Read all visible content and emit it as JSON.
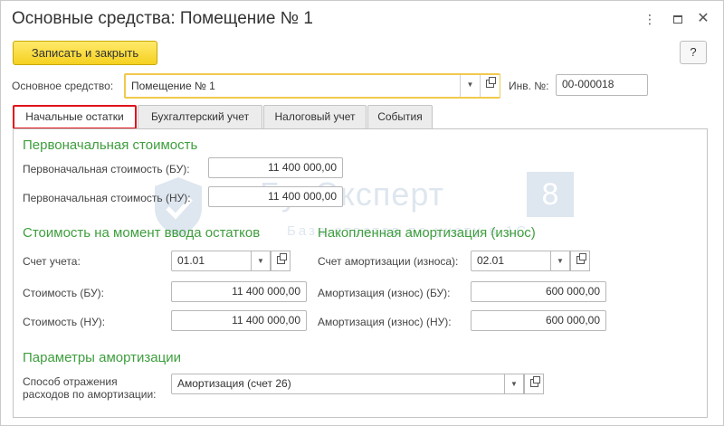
{
  "window": {
    "title": "Основные средства: Помещение № 1",
    "more_glyph": "⋮",
    "maximize_glyph": "",
    "close_glyph": "✕"
  },
  "toolbar": {
    "save_close_label": "Записать и закрыть",
    "help_label": "?"
  },
  "header": {
    "asset_label": "Основное средство:",
    "asset_value": "Помещение № 1",
    "inv_label": "Инв. №:",
    "inv_value": "00-000018"
  },
  "tabs": [
    {
      "label": "Начальные остатки",
      "active": true
    },
    {
      "label": "Бухгалтерский учет",
      "active": false
    },
    {
      "label": "Налоговый учет",
      "active": false
    },
    {
      "label": "События",
      "active": false
    }
  ],
  "initial_cost": {
    "section_title": "Первоначальная стоимость",
    "bu_label": "Первоначальная стоимость (БУ):",
    "bu_value": "11 400 000,00",
    "nu_label": "Первоначальная стоимость (НУ):",
    "nu_value": "11 400 000,00"
  },
  "balance_cost": {
    "section_title": "Стоимость на момент ввода остатков",
    "account_label": "Счет учета:",
    "account_value": "01.01",
    "bu_label": "Стоимость (БУ):",
    "bu_value": "11 400 000,00",
    "nu_label": "Стоимость (НУ):",
    "nu_value": "11 400 000,00"
  },
  "depreciation": {
    "section_title": "Накопленная амортизация (износ)",
    "account_label": "Счет амортизации (износа):",
    "account_value": "02.01",
    "bu_label": "Амортизация (износ) (БУ):",
    "bu_value": "600 000,00",
    "nu_label": "Амортизация (износ) (НУ):",
    "nu_value": "600 000,00"
  },
  "params": {
    "section_title": "Параметры амортизации",
    "method_label_line1": "Способ отражения",
    "method_label_line2": "расходов по амортизации:",
    "method_value": "Амортизация (счет 26)"
  },
  "watermark": {
    "brand": "БухЭксперт",
    "digit": "8",
    "tagline": "База ответов по учету в 1С"
  },
  "colors": {
    "section_green": "#3e9e3e",
    "active_tab_border": "#e0121b",
    "save_button": "#f5d11f",
    "focus_border": "#f2c94c"
  },
  "icons": {
    "dropdown": "chevron-down-icon",
    "open": "open-form-icon"
  }
}
